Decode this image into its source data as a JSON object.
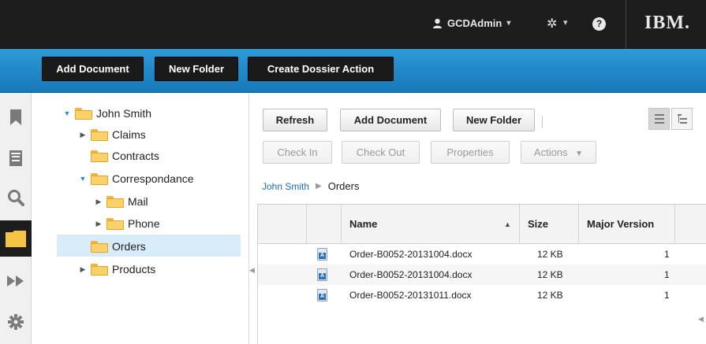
{
  "banner": {
    "user_name": "GCDAdmin",
    "brand": "IBM."
  },
  "action_bar": {
    "add_document": "Add Document",
    "new_folder": "New Folder",
    "create_dossier_action": "Create Dossier Action"
  },
  "rail": {
    "icons": [
      "bookmark-icon",
      "inbox-icon",
      "search-icon",
      "folder-icon",
      "fast-forward-icon",
      "gear-icon"
    ],
    "active": "folder-icon"
  },
  "tree": {
    "root": "John Smith",
    "items": [
      {
        "label": "Claims"
      },
      {
        "label": "Contracts"
      },
      {
        "label": "Correspondance"
      },
      {
        "label": "Mail"
      },
      {
        "label": "Phone"
      },
      {
        "label": "Orders"
      },
      {
        "label": "Products"
      }
    ],
    "selected": "Orders"
  },
  "toolbar": {
    "refresh": "Refresh",
    "add_document": "Add Document",
    "new_folder": "New Folder",
    "check_in": "Check In",
    "check_out": "Check Out",
    "properties": "Properties",
    "actions": "Actions"
  },
  "breadcrumb": {
    "parent": "John Smith",
    "current": "Orders"
  },
  "grid": {
    "columns": {
      "name": "Name",
      "size": "Size",
      "major_version": "Major Version"
    },
    "rows": [
      {
        "name": "Order-B0052-20131004.docx",
        "size": "12 KB",
        "major_version": "1"
      },
      {
        "name": "Order-B0052-20131004.docx",
        "size": "12 KB",
        "major_version": "1"
      },
      {
        "name": "Order-B0052-20131011.docx",
        "size": "12 KB",
        "major_version": "1"
      }
    ]
  },
  "colors": {
    "banner": "#1d1d1d",
    "action_bar": "#1f88c9",
    "selection": "#d8ebf8",
    "folder": "#fbd16a"
  }
}
